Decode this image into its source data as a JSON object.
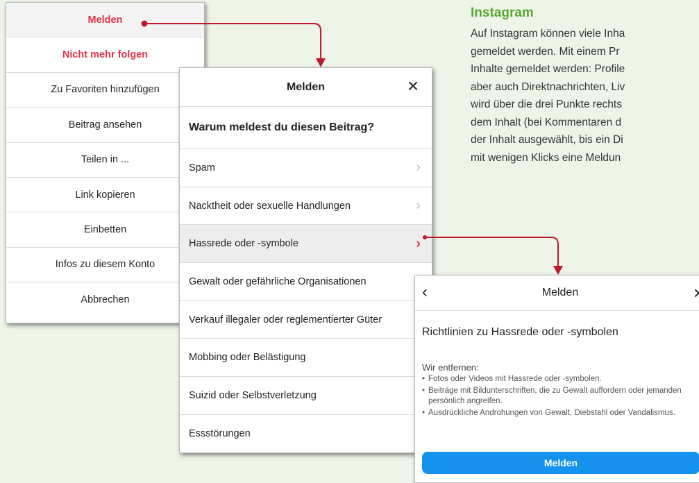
{
  "menu": {
    "items": [
      {
        "label": "Melden"
      },
      {
        "label": "Nicht mehr folgen"
      },
      {
        "label": "Zu Favoriten hinzufügen"
      },
      {
        "label": "Beitrag ansehen"
      },
      {
        "label": "Teilen in ..."
      },
      {
        "label": "Link kopieren"
      },
      {
        "label": "Einbetten"
      },
      {
        "label": "Infos zu diesem Konto"
      },
      {
        "label": "Abbrechen"
      }
    ]
  },
  "report": {
    "title": "Melden",
    "close_icon": "×",
    "question": "Warum meldest du diesen Beitrag?",
    "reasons": [
      {
        "label": "Spam"
      },
      {
        "label": "Nacktheit oder sexuelle Handlungen"
      },
      {
        "label": "Hassrede oder -symbole"
      },
      {
        "label": "Gewalt oder gefährliche Organisationen"
      },
      {
        "label": "Verkauf illegaler oder reglementierter Güter"
      },
      {
        "label": "Mobbing oder Belästigung"
      },
      {
        "label": "Suizid oder Selbstverletzung"
      },
      {
        "label": "Essstörungen"
      }
    ],
    "chevron": "›"
  },
  "guide": {
    "title": "Melden",
    "back_icon": "‹",
    "close_icon": "×",
    "heading": "Richtlinien zu Hassrede oder -symbolen",
    "subheading": "Wir entfernen:",
    "bullets": [
      "Fotos oder Videos mit Hassrede oder -symbolen.",
      "Beiträge mit Bildunterschriften, die zu Gewalt auffordern oder jemanden persönlich angreifen.",
      "Ausdrückliche Androhungen von Gewalt, Diebstahl oder Vandalismus."
    ],
    "button": "Melden"
  },
  "intro": {
    "title": "Instagram",
    "lines": [
      "Auf Instagram können viele Inha",
      "gemeldet werden. Mit einem Pr",
      "Inhalte gemeldet werden: Profile",
      "aber auch Direktnachrichten, Liv",
      "wird über die drei Punkte rechts",
      "dem Inhalt (bei Kommentaren d",
      "der Inhalt ausgewählt, bis ein Di",
      "mit wenigen Klicks eine Meldun"
    ]
  },
  "colors": {
    "accent_red": "#e0354a",
    "accent_green": "#5aa532",
    "button_blue": "#1592ec",
    "arrow": "#c0172a"
  }
}
